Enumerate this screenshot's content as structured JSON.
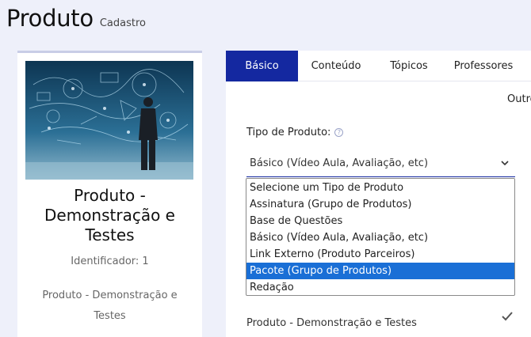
{
  "header": {
    "title": "Produto",
    "subtitle": "Cadastro"
  },
  "product_card": {
    "image_alt": "homem de terno observando diagramas de ideias",
    "name": "Produto - Demonstração e Testes",
    "identifier": "Identificador: 1",
    "description": "Produto - Demonstração e Testes"
  },
  "tabs": [
    {
      "label": "Básico",
      "active": true
    },
    {
      "label": "Conteúdo",
      "active": false
    },
    {
      "label": "Tópicos",
      "active": false
    },
    {
      "label": "Professores",
      "active": false
    }
  ],
  "form": {
    "outro_label": "Outro",
    "tipo_label": "Tipo de Produto:",
    "tipo_value": "Básico (Vídeo Aula, Avaliação, etc)",
    "dropdown_options": [
      "Selecione um Tipo de Produto",
      "Assinatura (Grupo de Produtos)",
      "Base de Questões",
      "Básico (Vídeo Aula, Avaliação, etc)",
      "Link Externo (Produto Parceiros)",
      "Pacote (Grupo de Produtos)",
      "Redação"
    ],
    "highlighted_option": "Pacote (Grupo de Produtos)",
    "name_value": "Produto - Demonstração e Testes"
  },
  "icons": {
    "help": "question-circle-icon",
    "select_arrow": "chevron-down-icon",
    "confirm": "check-icon"
  },
  "colors": {
    "accent": "#1428a0",
    "highlight": "#1a6fd6",
    "background": "#eef0fa"
  }
}
